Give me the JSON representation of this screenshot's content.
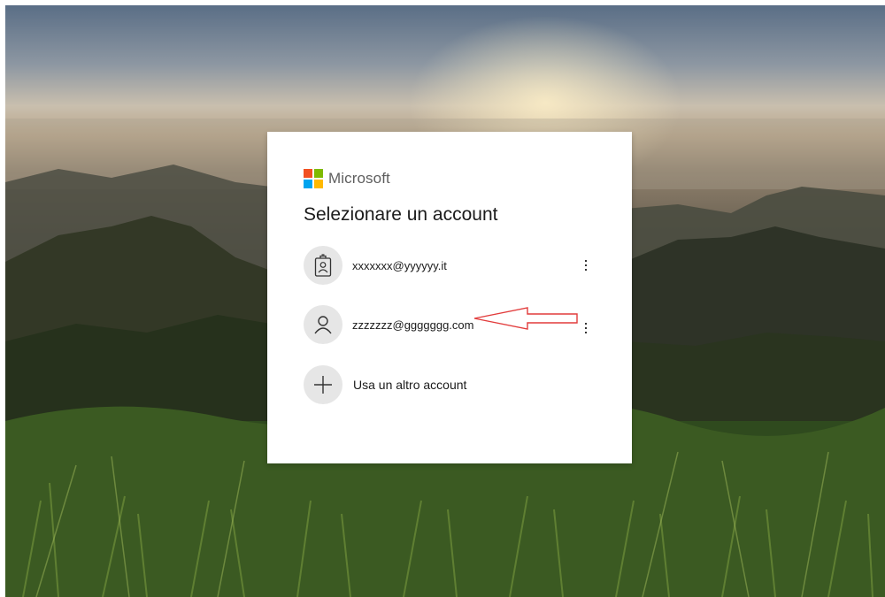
{
  "brand": {
    "name": "Microsoft",
    "logo_colors": [
      "#f25022",
      "#7fba00",
      "#00a4ef",
      "#ffb900"
    ]
  },
  "page_title": "Selezionare un account",
  "accounts": [
    {
      "email": "xxxxxxx@yyyyyy.it",
      "icon": "badge-person-icon"
    },
    {
      "email": "zzzzzzz@ggggggg.com",
      "icon": "person-icon"
    }
  ],
  "other_account": {
    "label": "Usa un altro account",
    "icon": "plus-icon"
  },
  "annotation": {
    "color": "#e23c3c"
  }
}
